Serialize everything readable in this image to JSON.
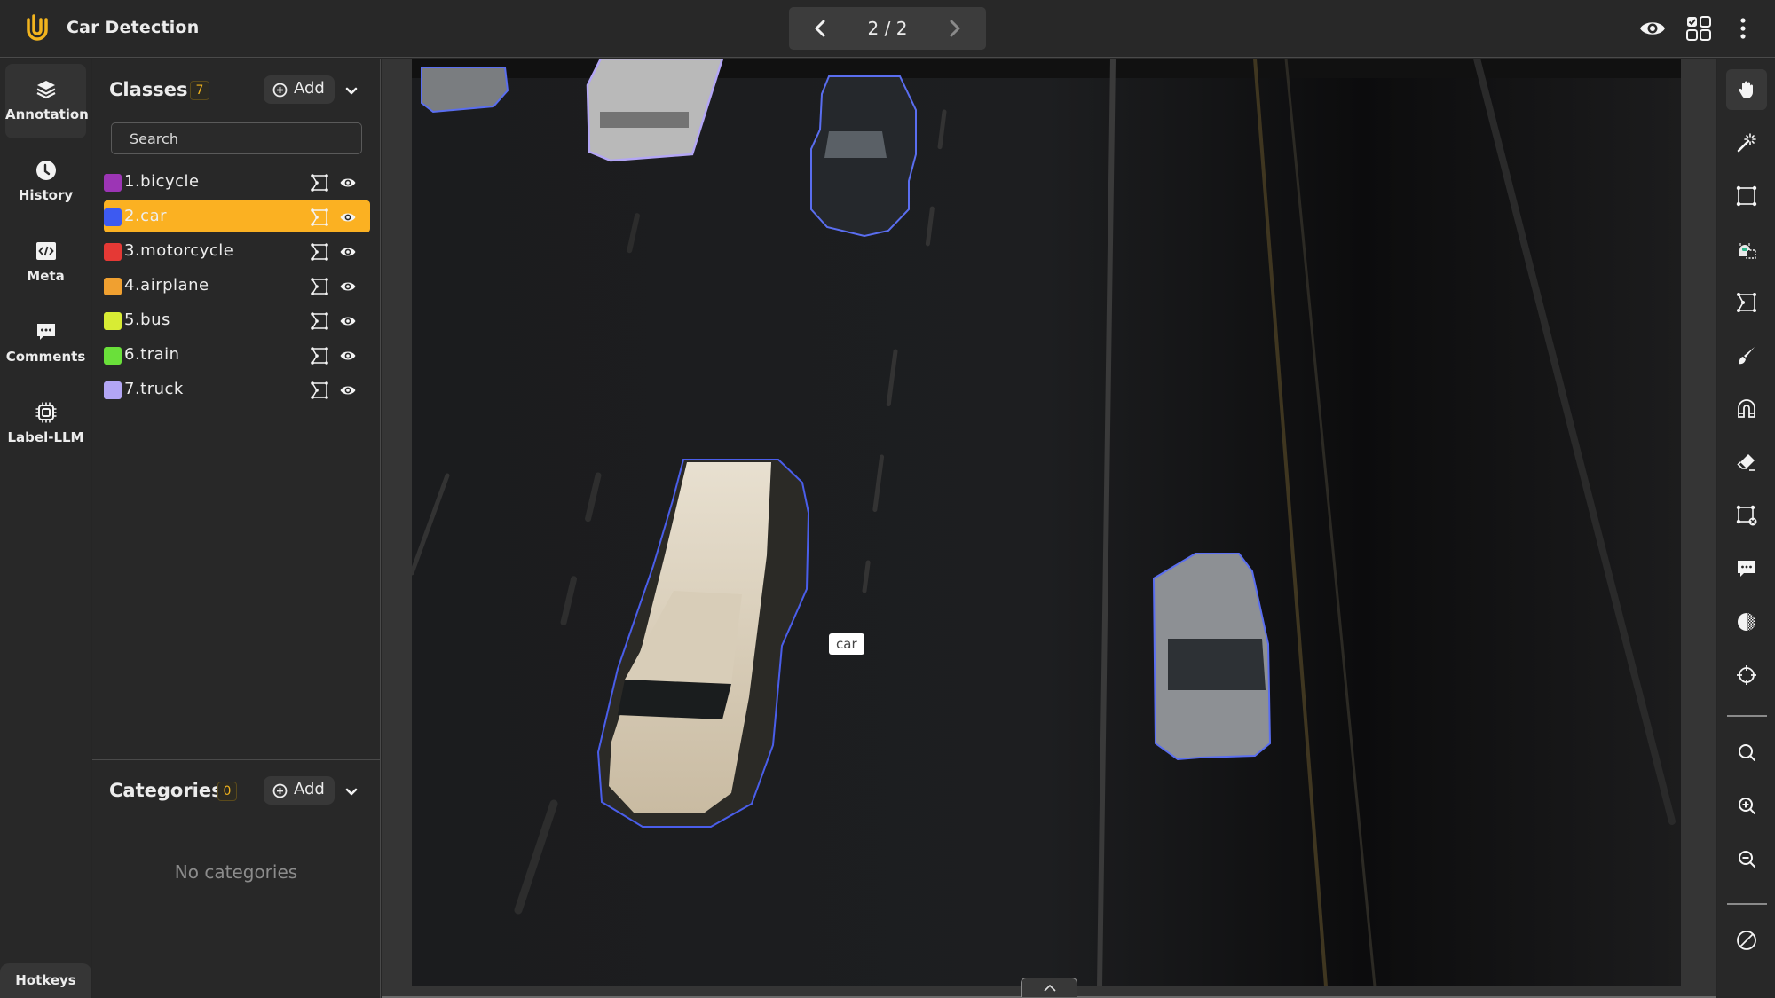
{
  "app": {
    "title": "Car Detection",
    "brand_color": "#F2B41E",
    "logo_icon": "paperclip-u-logo"
  },
  "pager": {
    "current": 2,
    "total": 2,
    "text": "2 / 2",
    "prev_icon": "chevron-left-icon",
    "next_icon": "chevron-right-icon"
  },
  "top_actions": [
    {
      "name": "visibility",
      "icon": "eye-icon"
    },
    {
      "name": "grid-view",
      "icon": "grid-check-icon"
    },
    {
      "name": "more",
      "icon": "kebab-menu-icon"
    }
  ],
  "rail": {
    "items": [
      {
        "label": "Annotation",
        "icon": "layers-icon",
        "active": true
      },
      {
        "label": "History",
        "icon": "clock-icon",
        "active": false
      },
      {
        "label": "Meta",
        "icon": "code-icon",
        "active": false
      },
      {
        "label": "Comments",
        "icon": "comment-icon",
        "active": false
      },
      {
        "label": "Label-LLM",
        "icon": "chip-icon",
        "active": false
      }
    ],
    "hotkeys_label": "Hotkeys"
  },
  "classes": {
    "title": "Classes",
    "count": "7",
    "add_label": "Add",
    "search_placeholder": "Search",
    "selected_index": 1,
    "selected_color": "#FBB122",
    "items": [
      {
        "label": "1.bicycle",
        "color": "#9C35B5"
      },
      {
        "label": "2.car",
        "color": "#3D5AF1"
      },
      {
        "label": "3.motorcycle",
        "color": "#E53935"
      },
      {
        "label": "4.airplane",
        "color": "#F0A030"
      },
      {
        "label": "5.bus",
        "color": "#D8EC34"
      },
      {
        "label": "6.train",
        "color": "#6AE03A"
      },
      {
        "label": "7.truck",
        "color": "#B3A6F5"
      }
    ]
  },
  "categories": {
    "title": "Categories",
    "count": "0",
    "add_label": "Add",
    "empty_text": "No categories"
  },
  "canvas": {
    "hover_tag": "car",
    "annotations": [
      {
        "class": "car",
        "color": "#5A6EF0"
      },
      {
        "class": "truck",
        "color": "#B3A6F5"
      },
      {
        "class": "car",
        "color": "#5A6EF0"
      },
      {
        "class": "car",
        "color": "#4A5EEA"
      },
      {
        "class": "car",
        "color": "#5A6EF0"
      }
    ]
  },
  "toolbar": {
    "tools": [
      {
        "name": "pan",
        "icon": "hand-icon",
        "active": true
      },
      {
        "name": "magic-wand",
        "icon": "magic-wand-icon"
      },
      {
        "name": "bounding-box",
        "icon": "rectangle-icon"
      },
      {
        "name": "auto-annotate",
        "icon": "robot-box-icon"
      },
      {
        "name": "polygon",
        "icon": "polygon-icon"
      },
      {
        "name": "brush",
        "icon": "brush-icon"
      },
      {
        "name": "magnetic",
        "icon": "magnet-icon"
      },
      {
        "name": "eraser",
        "icon": "eraser-icon"
      },
      {
        "name": "delete-points",
        "icon": "box-delete-icon"
      },
      {
        "name": "comment",
        "icon": "comment-icon"
      },
      {
        "name": "contrast",
        "icon": "contrast-icon"
      },
      {
        "name": "crosshair",
        "icon": "crosshair-icon"
      },
      {
        "name": "search",
        "icon": "search-icon"
      },
      {
        "name": "zoom-in",
        "icon": "zoom-in-icon"
      },
      {
        "name": "zoom-out",
        "icon": "zoom-out-icon"
      },
      {
        "name": "disable",
        "icon": "ban-icon"
      }
    ]
  }
}
